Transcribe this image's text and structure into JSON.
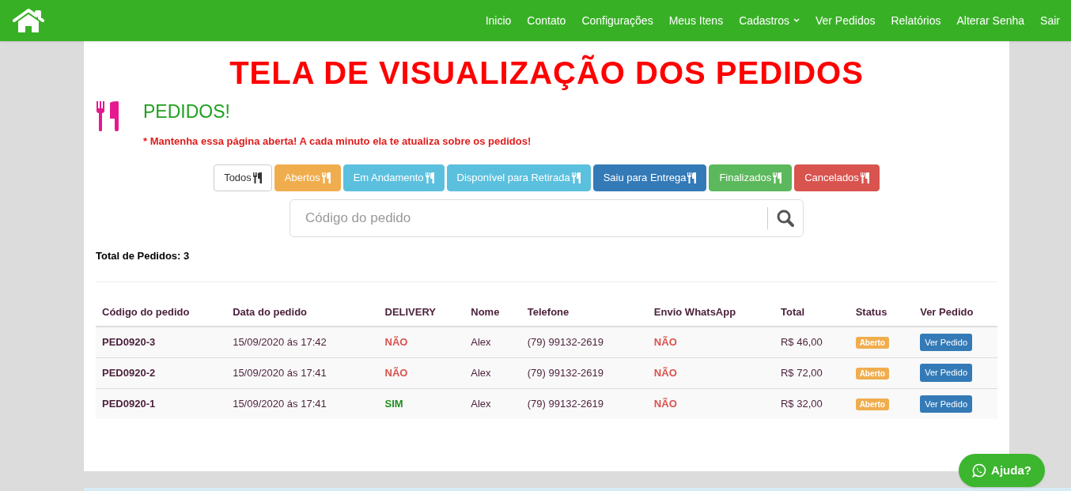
{
  "nav": {
    "items": [
      {
        "label": "Inicio",
        "dropdown": false
      },
      {
        "label": "Contato",
        "dropdown": false
      },
      {
        "label": "Configurações",
        "dropdown": false
      },
      {
        "label": "Meus Itens",
        "dropdown": false
      },
      {
        "label": "Cadastros",
        "dropdown": true
      },
      {
        "label": "Ver Pedidos",
        "dropdown": false
      },
      {
        "label": "Relatórios",
        "dropdown": false
      },
      {
        "label": "Alterar Senha",
        "dropdown": false
      },
      {
        "label": "Sair",
        "dropdown": false
      }
    ]
  },
  "banner": "TELA DE VISUALIZAÇÃO DOS PEDIDOS",
  "heading": "PEDIDOS!",
  "notice": "* Mantenha essa página aberta! A cada minuto ela te atualiza sobre os pedidos!",
  "filters": [
    {
      "label": "Todos",
      "color": "#ffffff"
    },
    {
      "label": "Abertos",
      "color": "#f0ad4e"
    },
    {
      "label": "Em Andamento",
      "color": "#5bc0de"
    },
    {
      "label": "Disponível para Retirada",
      "color": "#5bc0de"
    },
    {
      "label": "Saiu para Entrega",
      "color": "#337ab7"
    },
    {
      "label": "Finalizados",
      "color": "#5cb85c"
    },
    {
      "label": "Cancelados",
      "color": "#d9534f"
    }
  ],
  "search": {
    "placeholder": "Código do pedido"
  },
  "total": "Total de Pedidos: 3",
  "table": {
    "columns": [
      "Código do pedido",
      "Data do pedido",
      "DELIVERY",
      "Nome",
      "Telefone",
      "Envio WhatsApp",
      "Total",
      "Status",
      "Ver Pedido"
    ],
    "rows": [
      {
        "code": "PED0920-3",
        "date": "15/09/2020 ás 17:42",
        "delivery": {
          "text": "NÃO",
          "color": "#d9534f"
        },
        "name": "Alex",
        "phone": "(79) 99132-2619",
        "whatsapp": {
          "text": "NÃO",
          "color": "#d9534f"
        },
        "total": "R$ 46,00",
        "status": "Aberto",
        "action": "Ver Pedido"
      },
      {
        "code": "PED0920-2",
        "date": "15/09/2020 ás 17:41",
        "delivery": {
          "text": "NÃO",
          "color": "#d9534f"
        },
        "name": "Alex",
        "phone": "(79) 99132-2619",
        "whatsapp": {
          "text": "NÃO",
          "color": "#d9534f"
        },
        "total": "R$ 72,00",
        "status": "Aberto",
        "action": "Ver Pedido"
      },
      {
        "code": "PED0920-1",
        "date": "15/09/2020 ás 17:41",
        "delivery": {
          "text": "SIM",
          "color": "#1e8f1e"
        },
        "name": "Alex",
        "phone": "(79) 99132-2619",
        "whatsapp": {
          "text": "NÃO",
          "color": "#d9534f"
        },
        "total": "R$ 32,00",
        "status": "Aberto",
        "action": "Ver Pedido"
      }
    ]
  },
  "help_button": "Ajuda?"
}
